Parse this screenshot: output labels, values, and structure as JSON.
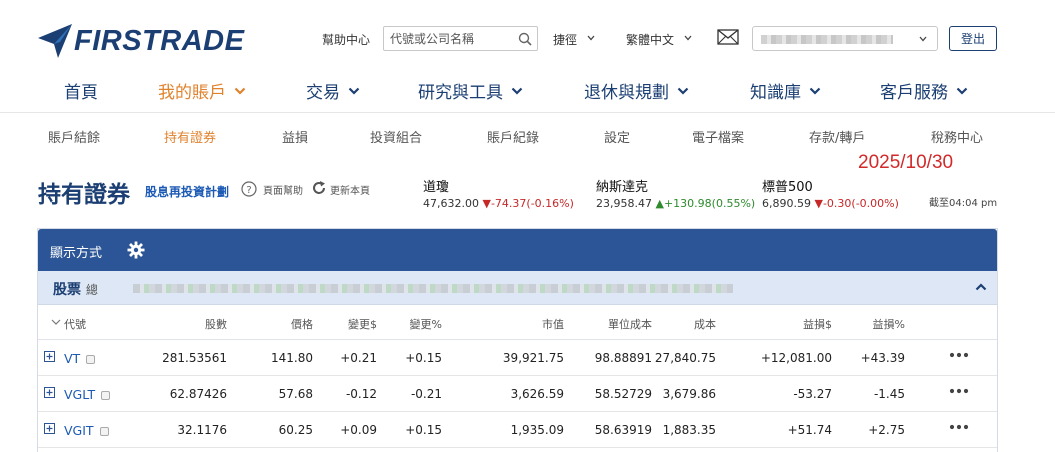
{
  "brand": {
    "name": "FIRSTRADE"
  },
  "header": {
    "help_center": "幫助中心",
    "search_placeholder": "代號或公司名稱",
    "shortcut": "捷徑",
    "language": "繁體中文",
    "logout": "登出"
  },
  "main_nav": [
    {
      "label": "首頁",
      "has_menu": false
    },
    {
      "label": "我的賬戶",
      "has_menu": true,
      "active": true
    },
    {
      "label": "交易",
      "has_menu": true
    },
    {
      "label": "研究與工具",
      "has_menu": true
    },
    {
      "label": "退休與規劃",
      "has_menu": true
    },
    {
      "label": "知識庫",
      "has_menu": true
    },
    {
      "label": "客戶服務",
      "has_menu": true
    }
  ],
  "sub_nav": [
    {
      "label": "賬戶結餘"
    },
    {
      "label": "持有證券",
      "active": true
    },
    {
      "label": "益損"
    },
    {
      "label": "投資組合"
    },
    {
      "label": "賬戶紀錄"
    },
    {
      "label": "設定"
    },
    {
      "label": "電子檔案"
    },
    {
      "label": "存款/轉戶"
    },
    {
      "label": "稅務中心"
    }
  ],
  "date_stamp": "2025/10/30",
  "page": {
    "title": "持有證券",
    "drip_link": "股息再投資計劃",
    "page_help": "頁面幫助",
    "refresh": "更新本頁"
  },
  "indices": [
    {
      "name": "道瓊",
      "value": "47,632.00",
      "arrow": "▼",
      "change": "-74.37(-0.16%)",
      "dir": "neg"
    },
    {
      "name": "納斯達克",
      "value": "23,958.47",
      "arrow": "▲",
      "change": "+130.98(0.55%)",
      "dir": "pos"
    },
    {
      "name": "標普500",
      "value": "6,890.59",
      "arrow": "▼",
      "change": "-0.30(-0.00%)",
      "dir": "neg"
    }
  ],
  "as_of": "截至04:04 pm",
  "panel": {
    "display_label": "顯示方式",
    "section_title": "股票",
    "section_prefix": "總"
  },
  "columns": [
    "代號",
    "股數",
    "價格",
    "變更$",
    "變更%",
    "市值",
    "單位成本",
    "成本",
    "益損$",
    "益損%"
  ],
  "rows": [
    {
      "symbol": "VT",
      "shares": "281.53561",
      "price": "141.80",
      "chg": "+0.21",
      "chg_pct": "+0.15",
      "mkt_value": "39,921.75",
      "unit_cost": "98.88891",
      "cost": "27,840.75",
      "gl": "+12,081.00",
      "gl_pct": "+43.39",
      "chg_dir": "pos",
      "gl_dir": "pos"
    },
    {
      "symbol": "VGLT",
      "shares": "62.87426",
      "price": "57.68",
      "chg": "-0.12",
      "chg_pct": "-0.21",
      "mkt_value": "3,626.59",
      "unit_cost": "58.52729",
      "cost": "3,679.86",
      "gl": "-53.27",
      "gl_pct": "-1.45",
      "chg_dir": "neg",
      "gl_dir": "neg"
    },
    {
      "symbol": "VGIT",
      "shares": "32.1176",
      "price": "60.25",
      "chg": "+0.09",
      "chg_pct": "+0.15",
      "mkt_value": "1,935.09",
      "unit_cost": "58.63919",
      "cost": "1,883.35",
      "gl": "+51.74",
      "gl_pct": "+2.75",
      "chg_dir": "pos",
      "gl_dir": "pos"
    }
  ],
  "colors": {
    "brand_navy": "#1c3f73",
    "accent_orange": "#e0832e",
    "panel_blue": "#2b5597",
    "loss_red": "#c62828",
    "gain_green": "#2e8b2e",
    "date_red": "#d22a2a"
  }
}
